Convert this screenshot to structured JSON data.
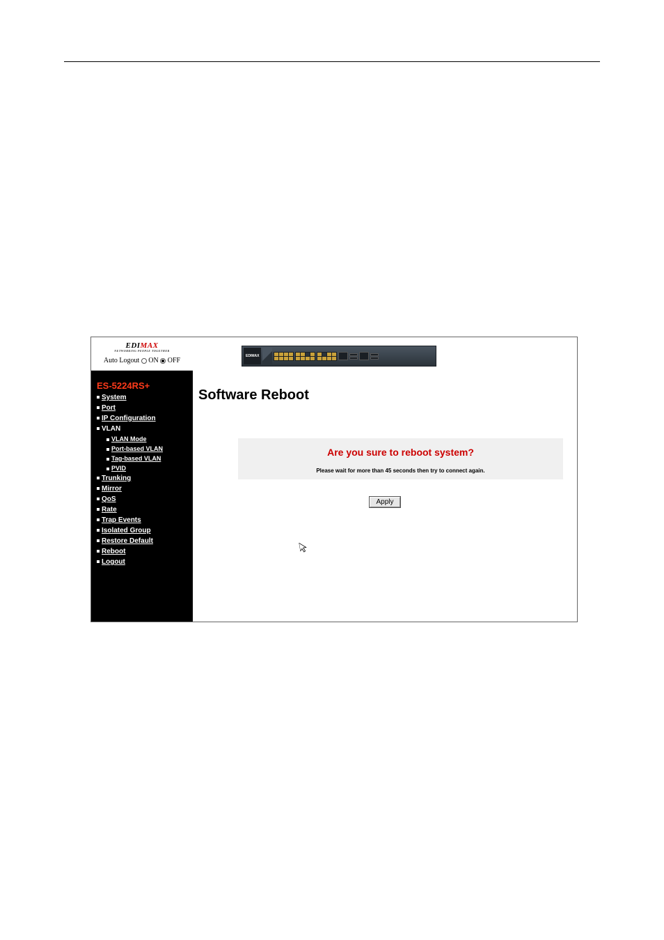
{
  "header": {
    "logo_left": "EDI",
    "logo_right": "MAX",
    "logo_subtitle": "NETWORKING PEOPLE TOGETHER",
    "auto_logout_label": "Auto Logout",
    "auto_logout_on": "ON",
    "auto_logout_off": "OFF",
    "auto_logout_value": "OFF"
  },
  "sidebar": {
    "model": "ES-5224RS+",
    "items": [
      {
        "label": "System",
        "type": "link"
      },
      {
        "label": "Port",
        "type": "link"
      },
      {
        "label": "IP Configuration",
        "type": "link"
      },
      {
        "label": "VLAN",
        "type": "plain"
      },
      {
        "label": "VLAN Mode",
        "type": "sublink"
      },
      {
        "label": "Port-based VLAN",
        "type": "sublink"
      },
      {
        "label": "Tag-based VLAN",
        "type": "sublink"
      },
      {
        "label": "PVID",
        "type": "sublink"
      },
      {
        "label": "Trunking",
        "type": "link"
      },
      {
        "label": "Mirror",
        "type": "link"
      },
      {
        "label": "QoS",
        "type": "link"
      },
      {
        "label": "Rate",
        "type": "link"
      },
      {
        "label": "Trap Events",
        "type": "link"
      },
      {
        "label": "Isolated Group",
        "type": "link"
      },
      {
        "label": "Restore Default",
        "type": "link"
      },
      {
        "label": "Reboot",
        "type": "link"
      },
      {
        "label": "Logout",
        "type": "link"
      }
    ]
  },
  "switch_graphic": {
    "brand": "EDIMAX"
  },
  "main": {
    "title": "Software Reboot",
    "confirm_title": "Are you sure to reboot system?",
    "confirm_subtitle": "Please wait for more than 45 seconds then try to connect again.",
    "apply_label": "Apply"
  }
}
